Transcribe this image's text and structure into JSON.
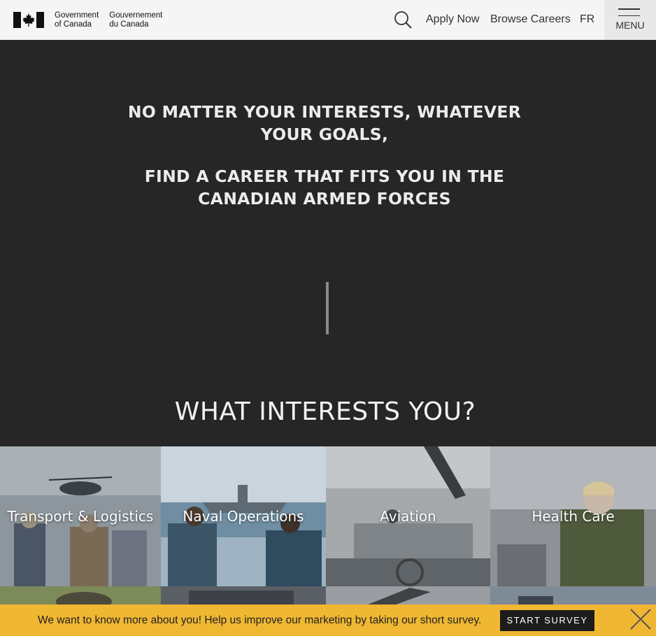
{
  "header": {
    "logo": {
      "en_line1": "Government",
      "en_line2": "of Canada",
      "fr_line1": "Gouvernement",
      "fr_line2": "du Canada"
    },
    "search_icon": "search-icon",
    "apply_label": "Apply Now",
    "browse_label": "Browse Careers",
    "lang_label": "FR",
    "menu_label": "MENU"
  },
  "hero": {
    "line1": "NO MATTER YOUR INTERESTS, WHATEVER YOUR GOALS,",
    "line2": "FIND A CAREER THAT FITS YOU IN THE CANADIAN ARMED FORCES"
  },
  "interests": {
    "title": "WHAT INTERESTS YOU?",
    "tiles": [
      {
        "label": "Transport & Logistics"
      },
      {
        "label": "Naval Operations"
      },
      {
        "label": "Aviation"
      },
      {
        "label": "Health Care"
      }
    ]
  },
  "survey": {
    "text": "We want to know more about you! Help us improve our marketing by taking our short survey.",
    "button_label": "START SURVEY",
    "close_icon": "close-icon"
  },
  "colors": {
    "background": "#262626",
    "header_bg": "#f5f5f5",
    "survey_bg": "#f0b732",
    "survey_button": "#1c1c1c"
  }
}
